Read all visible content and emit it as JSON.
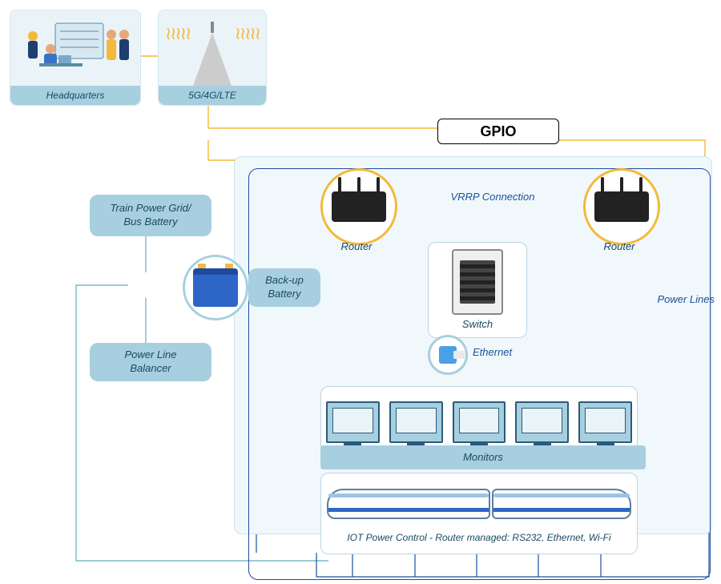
{
  "top": {
    "headquarters_label": "Headquarters",
    "cell_label": "5G/4G/LTE"
  },
  "gpio_label": "GPIO",
  "left": {
    "power_grid": "Train Power Grid/\nBus Battery",
    "backup_battery": "Back-up\nBattery",
    "power_line_balancer": "Power Line\nBalancer"
  },
  "net": {
    "router_label_left": "Router",
    "router_label_right": "Router",
    "vrrp": "VRRP Connection",
    "switch_label": "Switch",
    "ethernet_label": "Ethernet",
    "power_lines": "Power Lines"
  },
  "monitors_label": "Monitors",
  "iot_caption": "IOT Power Control - Router managed: RS232, Ethernet, Wi-Fi"
}
